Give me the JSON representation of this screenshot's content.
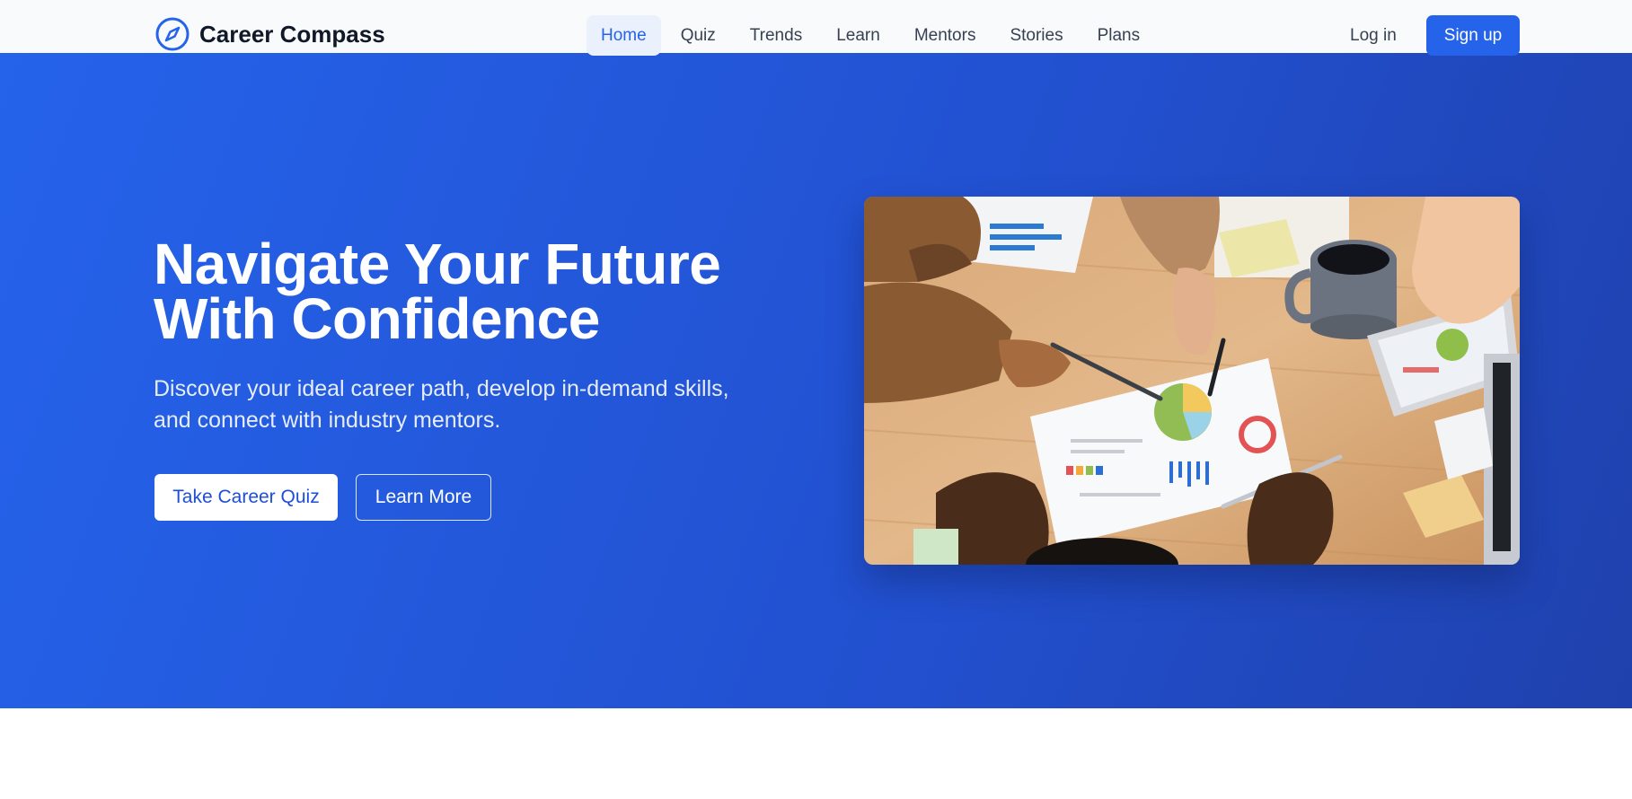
{
  "brand": {
    "name": "Career Compass",
    "logo_icon": "compass-icon",
    "accent": "#2563eb"
  },
  "nav": {
    "items": [
      {
        "label": "Home",
        "active": true
      },
      {
        "label": "Quiz",
        "active": false
      },
      {
        "label": "Trends",
        "active": false
      },
      {
        "label": "Learn",
        "active": false
      },
      {
        "label": "Mentors",
        "active": false
      },
      {
        "label": "Stories",
        "active": false
      },
      {
        "label": "Plans",
        "active": false
      }
    ],
    "login_label": "Log in",
    "signup_label": "Sign up"
  },
  "hero": {
    "headline_line1": "Navigate Your Future",
    "headline_line2": "With Confidence",
    "subtext_line1": "Discover your ideal career path, develop in-demand skills,",
    "subtext_line2": "and connect with industry mentors.",
    "primary_cta": "Take Career Quiz",
    "secondary_cta": "Learn More",
    "image_subject": "team reviewing charts at a wooden table",
    "background_color": "#2563eb"
  }
}
